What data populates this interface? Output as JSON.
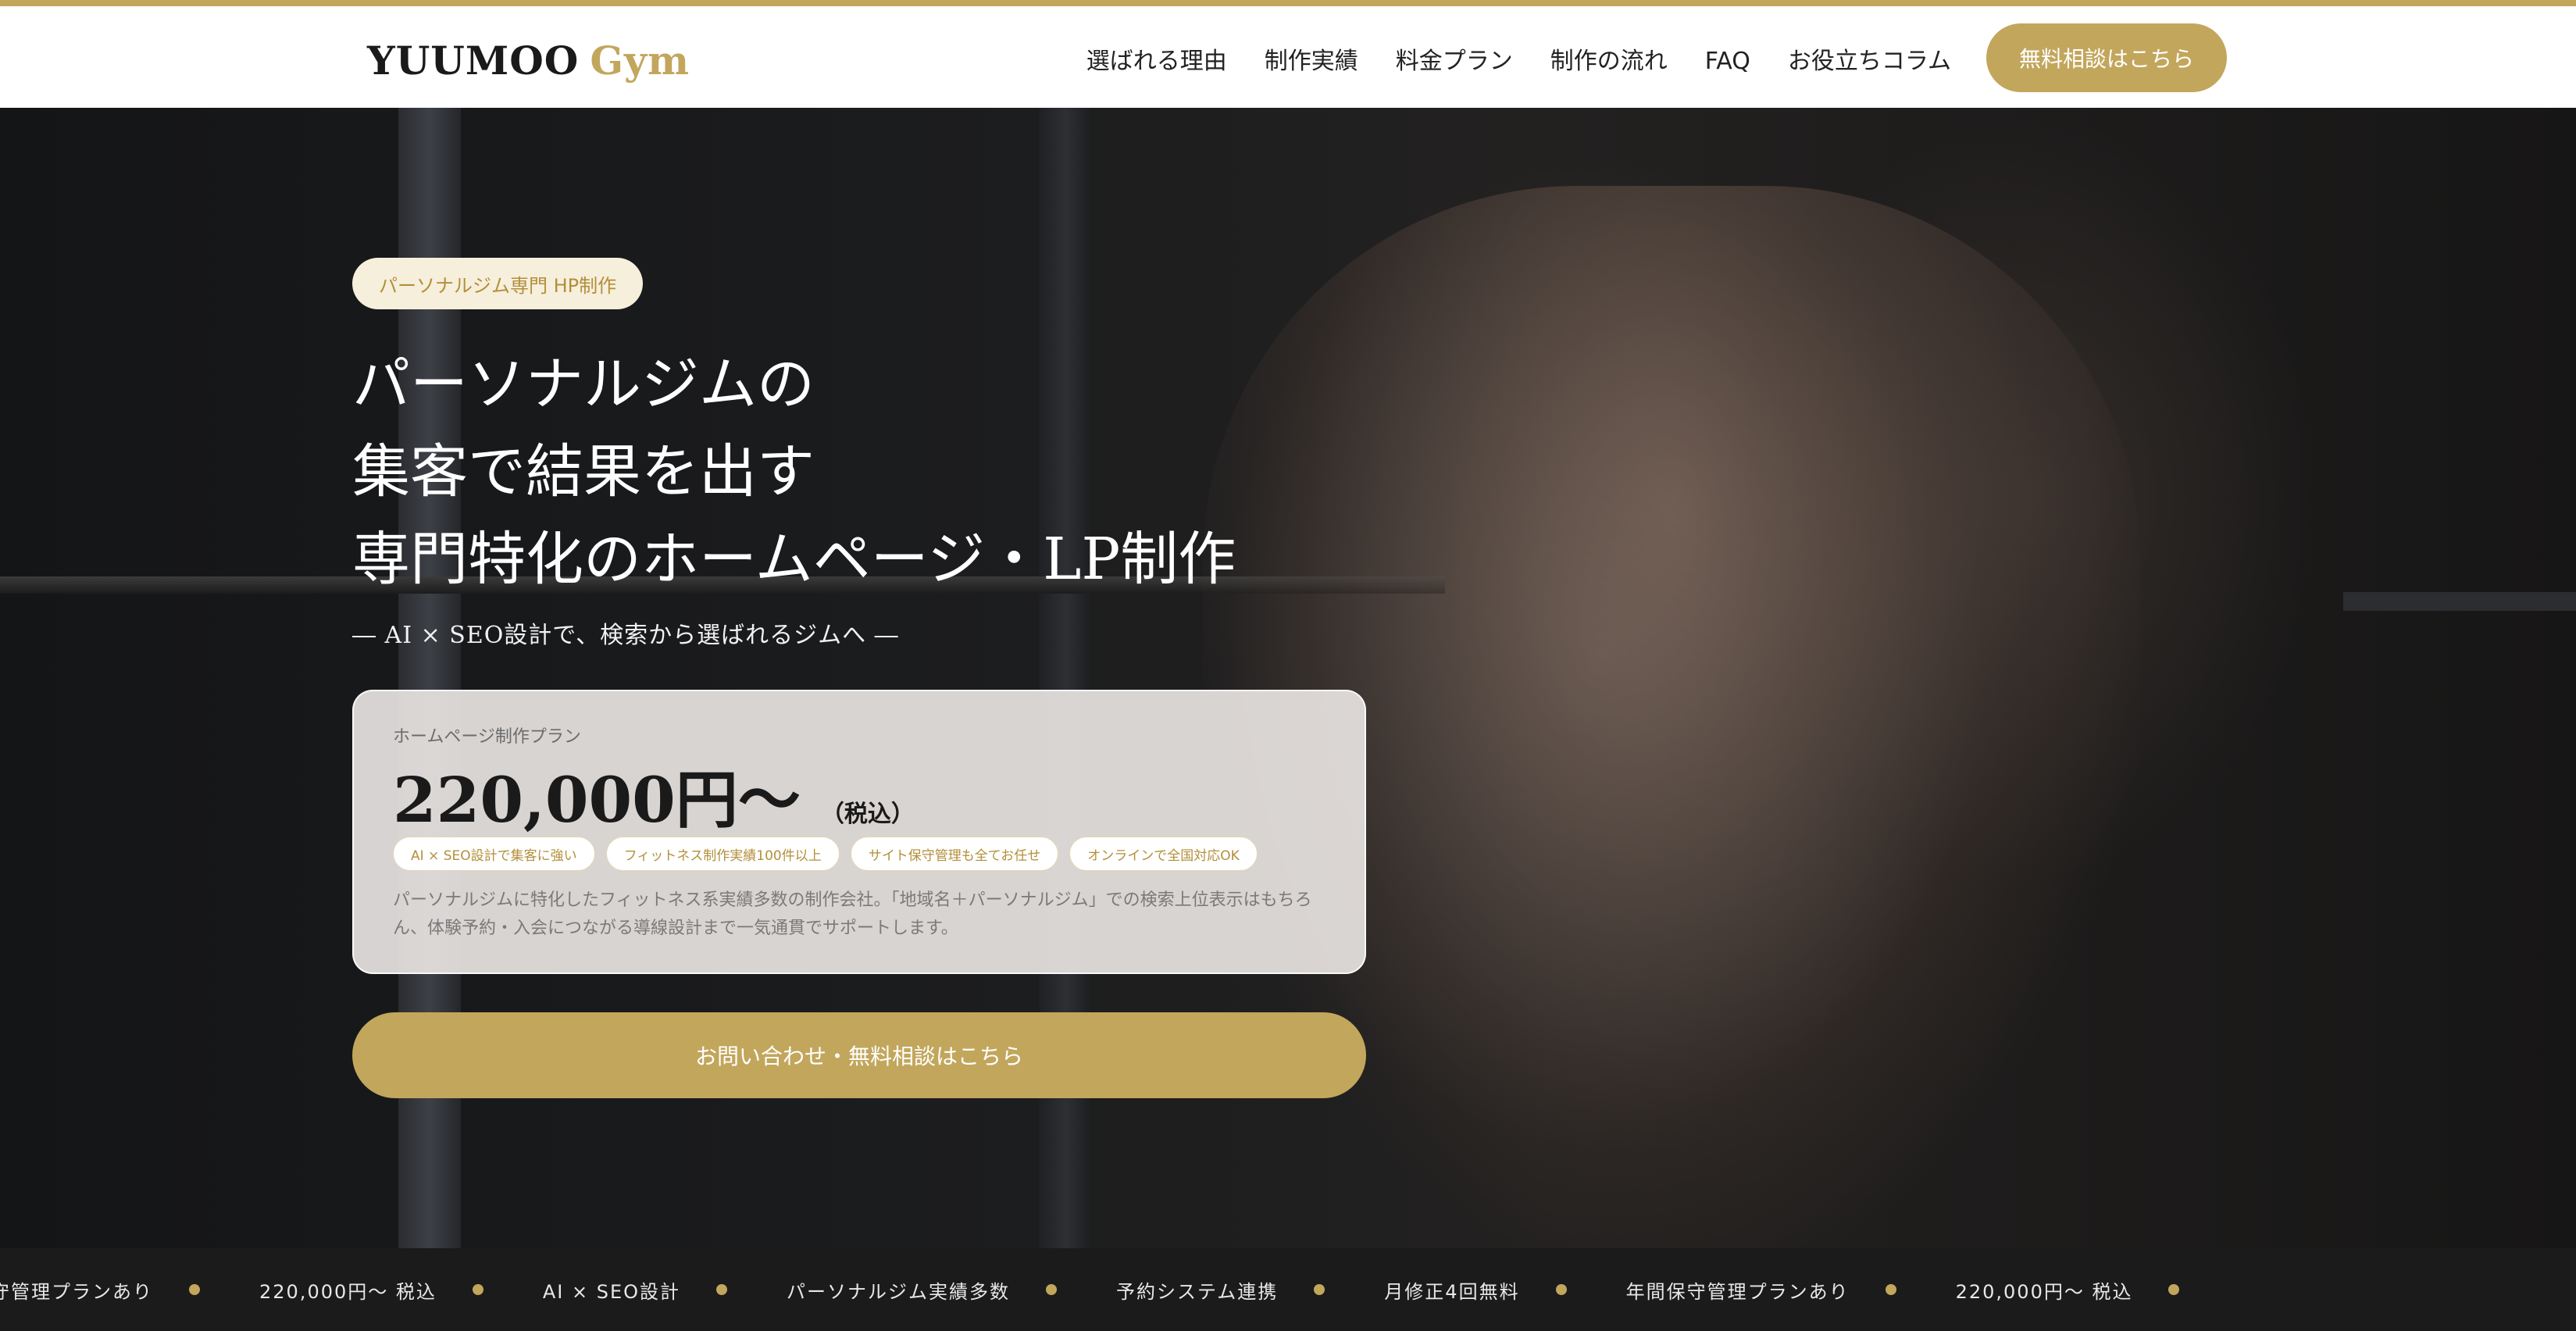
{
  "brand": {
    "name": "YUUMOO",
    "suffix": "Gym",
    "accent": "#c2a65c"
  },
  "nav": {
    "items": [
      "選ばれる理由",
      "制作実績",
      "料金プラン",
      "制作の流れ",
      "FAQ",
      "お役立ちコラム"
    ],
    "cta": "無料相談はこちら"
  },
  "hero": {
    "badge": "パーソナルジム専門 HP制作",
    "headline": [
      "パーソナルジムの",
      "集客で結果を出す",
      "専門特化のホームページ・LP制作"
    ],
    "subheadline": "― AI × SEO設計で、検索から選ばれるジムへ ―",
    "plan": {
      "label": "ホームページ制作プラン",
      "price": "220,000円〜",
      "tax": "（税込）",
      "chips": [
        "AI × SEO設計で集客に強い",
        "フィットネス制作実績100件以上",
        "サイト保守管理も全てお任せ",
        "オンラインで全国対応OK"
      ],
      "description": "パーソナルジムに特化したフィットネス系実績多数の制作会社。「地域名＋パーソナルジム」での検索上位表示はもちろん、体験予約・入会につながる導線設計まで一気通貫でサポートします。"
    },
    "cta": "お問い合わせ・無料相談はこちら"
  },
  "ticker": {
    "items": [
      "年間保守管理プランあり",
      "220,000円〜 税込",
      "AI × SEO設計",
      "パーソナルジム実績多数",
      "予約システム連携",
      "月修正4回無料",
      "年間保守管理プランあり",
      "220,000円〜 税込"
    ]
  }
}
